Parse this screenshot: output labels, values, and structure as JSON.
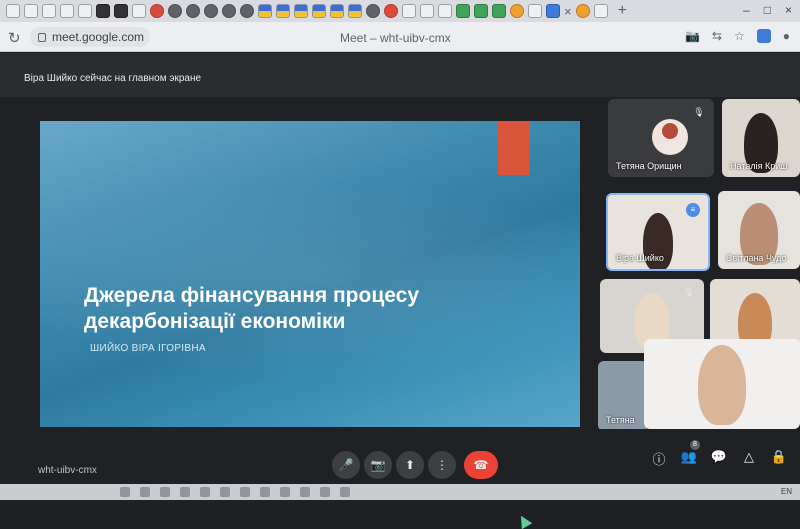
{
  "browser": {
    "tab_close_glyph": "×",
    "new_tab_glyph": "+",
    "url": "meet.google.com",
    "tab_title": "Meet – wht-uibv-cmx",
    "window_controls": [
      "–",
      "□",
      "×"
    ],
    "tab_favicons": [
      "page",
      "page",
      "page",
      "page",
      "doc",
      "app-dark",
      "grid",
      "ext-label",
      "record-red",
      "circle-grey",
      "circle-grey",
      "circle-grey",
      "circle-grey",
      "circle-grey",
      "flag-ua",
      "flag-ua",
      "flag-ua",
      "flag-ua",
      "flag-ua",
      "flag-ua",
      "circle-grey",
      "mail",
      "doc",
      "doc",
      "doc",
      "arrow",
      "drive-green",
      "drive-green",
      "euro",
      "doc",
      "meet",
      "orange",
      "doc"
    ]
  },
  "meet": {
    "presenter_note": "Віра Шийко сейчас на главном экране",
    "presentation": {
      "title": "Джерела фінансування процесу декарбонізації економіки",
      "author": "ШИЙКО ВІРА ІГОРІВНА"
    },
    "participants": [
      {
        "name": "Тетяна Орищин",
        "mic_icon": "mic-off-icon"
      },
      {
        "name": "Наталія Криш",
        "mic_icon": ""
      },
      {
        "name": "Віра Шийко",
        "mic_icon": "speaking-icon"
      },
      {
        "name": "Світлана Чудо",
        "mic_icon": ""
      },
      {
        "name": "",
        "mic_icon": "mic-off-icon"
      },
      {
        "name": "",
        "mic_icon": ""
      },
      {
        "name": "Тетяна",
        "mic_icon": ""
      },
      {
        "name": "",
        "mic_icon": ""
      }
    ],
    "meeting_code": "wht-uibv-cmx",
    "controls": {
      "mic": "🎤",
      "camera": "📷",
      "present": "⬆",
      "more": "⋮",
      "end_call": "☎"
    },
    "side_controls": {
      "info": "ⓘ",
      "people": "👥",
      "people_count": "8",
      "chat": "💬",
      "activities": "△",
      "host": "🔒"
    }
  },
  "taskbar": {
    "tray_text": "EN"
  }
}
